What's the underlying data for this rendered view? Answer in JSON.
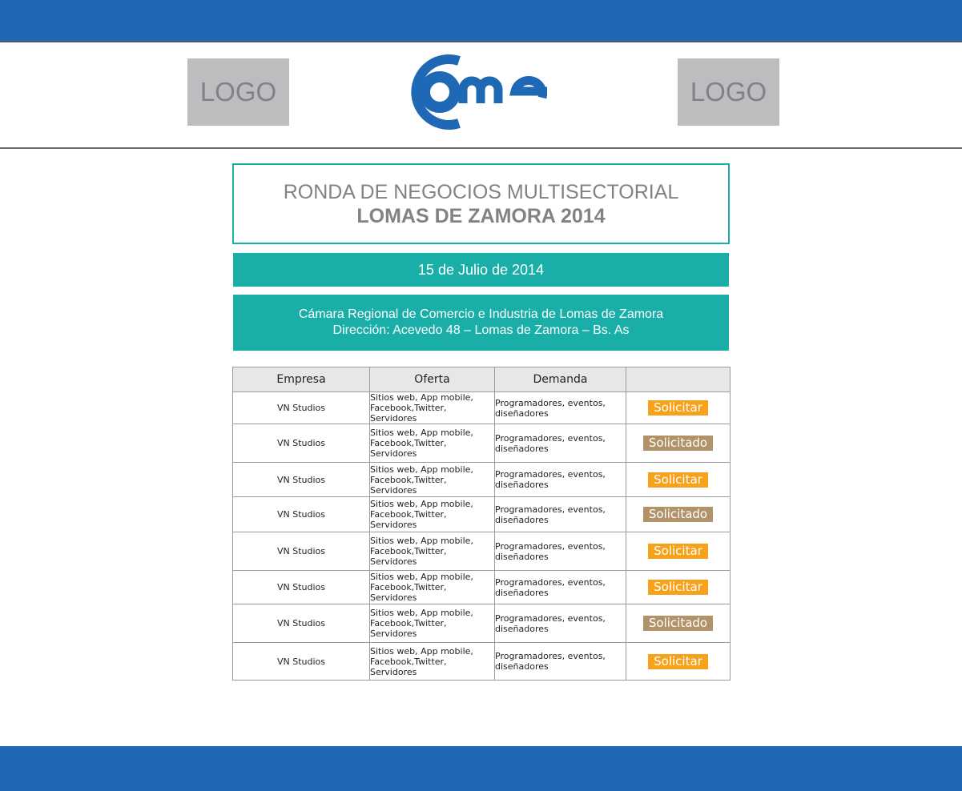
{
  "header": {
    "logo_left": "LOGO",
    "logo_right": "LOGO",
    "brand_name": "came"
  },
  "event": {
    "title_line1": "RONDA DE NEGOCIOS MULTISECTORIAL",
    "title_line2": "LOMAS DE ZAMORA 2014",
    "date": "15 de Julio de 2014",
    "venue_line1": "Cámara Regional de Comercio e Industria de Lomas de Zamora",
    "venue_line2": "Dirección: Acevedo 48 – Lomas de Zamora – Bs. As"
  },
  "table": {
    "columns": [
      "Empresa",
      "Oferta",
      "Demanda",
      ""
    ],
    "rows": [
      {
        "empresa": "VN Studios",
        "oferta_1": "Sitios web, App mobile,",
        "oferta_2": "Facebook,Twitter, Servidores",
        "demanda_1": "Programadores, eventos,",
        "demanda_2": "diseñadores",
        "action": "Solicitar"
      },
      {
        "empresa": "VN Studios",
        "oferta_1": "Sitios web, App mobile,",
        "oferta_2": "Facebook,Twitter, Servidores",
        "demanda_1": "Programadores, eventos,",
        "demanda_2": "diseñadores",
        "action": "Solicitado"
      },
      {
        "empresa": "VN Studios",
        "oferta_1": "Sitios web, App mobile,",
        "oferta_2": "Facebook,Twitter, Servidores",
        "demanda_1": "Programadores, eventos,",
        "demanda_2": "diseñadores",
        "action": "Solicitar"
      },
      {
        "empresa": "VN Studios",
        "oferta_1": "Sitios web, App mobile,",
        "oferta_2": "Facebook,Twitter, Servidores",
        "demanda_1": "Programadores, eventos,",
        "demanda_2": "diseñadores",
        "action": "Solicitado"
      },
      {
        "empresa": "VN Studios",
        "oferta_1": "Sitios web, App mobile,",
        "oferta_2": "Facebook,Twitter, Servidores",
        "demanda_1": "Programadores, eventos,",
        "demanda_2": "diseñadores",
        "action": "Solicitar"
      },
      {
        "empresa": "VN Studios",
        "oferta_1": "Sitios web, App mobile,",
        "oferta_2": "Facebook,Twitter, Servidores",
        "demanda_1": "Programadores, eventos,",
        "demanda_2": "diseñadores",
        "action": "Solicitar"
      },
      {
        "empresa": "VN Studios",
        "oferta_1": "Sitios web, App mobile,",
        "oferta_2": "Facebook,Twitter, Servidores",
        "demanda_1": "Programadores, eventos,",
        "demanda_2": "diseñadores",
        "action": "Solicitado"
      },
      {
        "empresa": "VN Studios",
        "oferta_1": "Sitios web, App mobile,",
        "oferta_2": "Facebook,Twitter, Servidores",
        "demanda_1": "Programadores, eventos,",
        "demanda_2": "diseñadores",
        "action": "Solicitar"
      }
    ]
  },
  "colors": {
    "brand_blue": "#1e68b5",
    "accent_teal": "#1aaea8",
    "button_solicitar": "#f7a21b",
    "button_solicitado": "#b29268",
    "placeholder_gray": "#bcbdbf"
  }
}
